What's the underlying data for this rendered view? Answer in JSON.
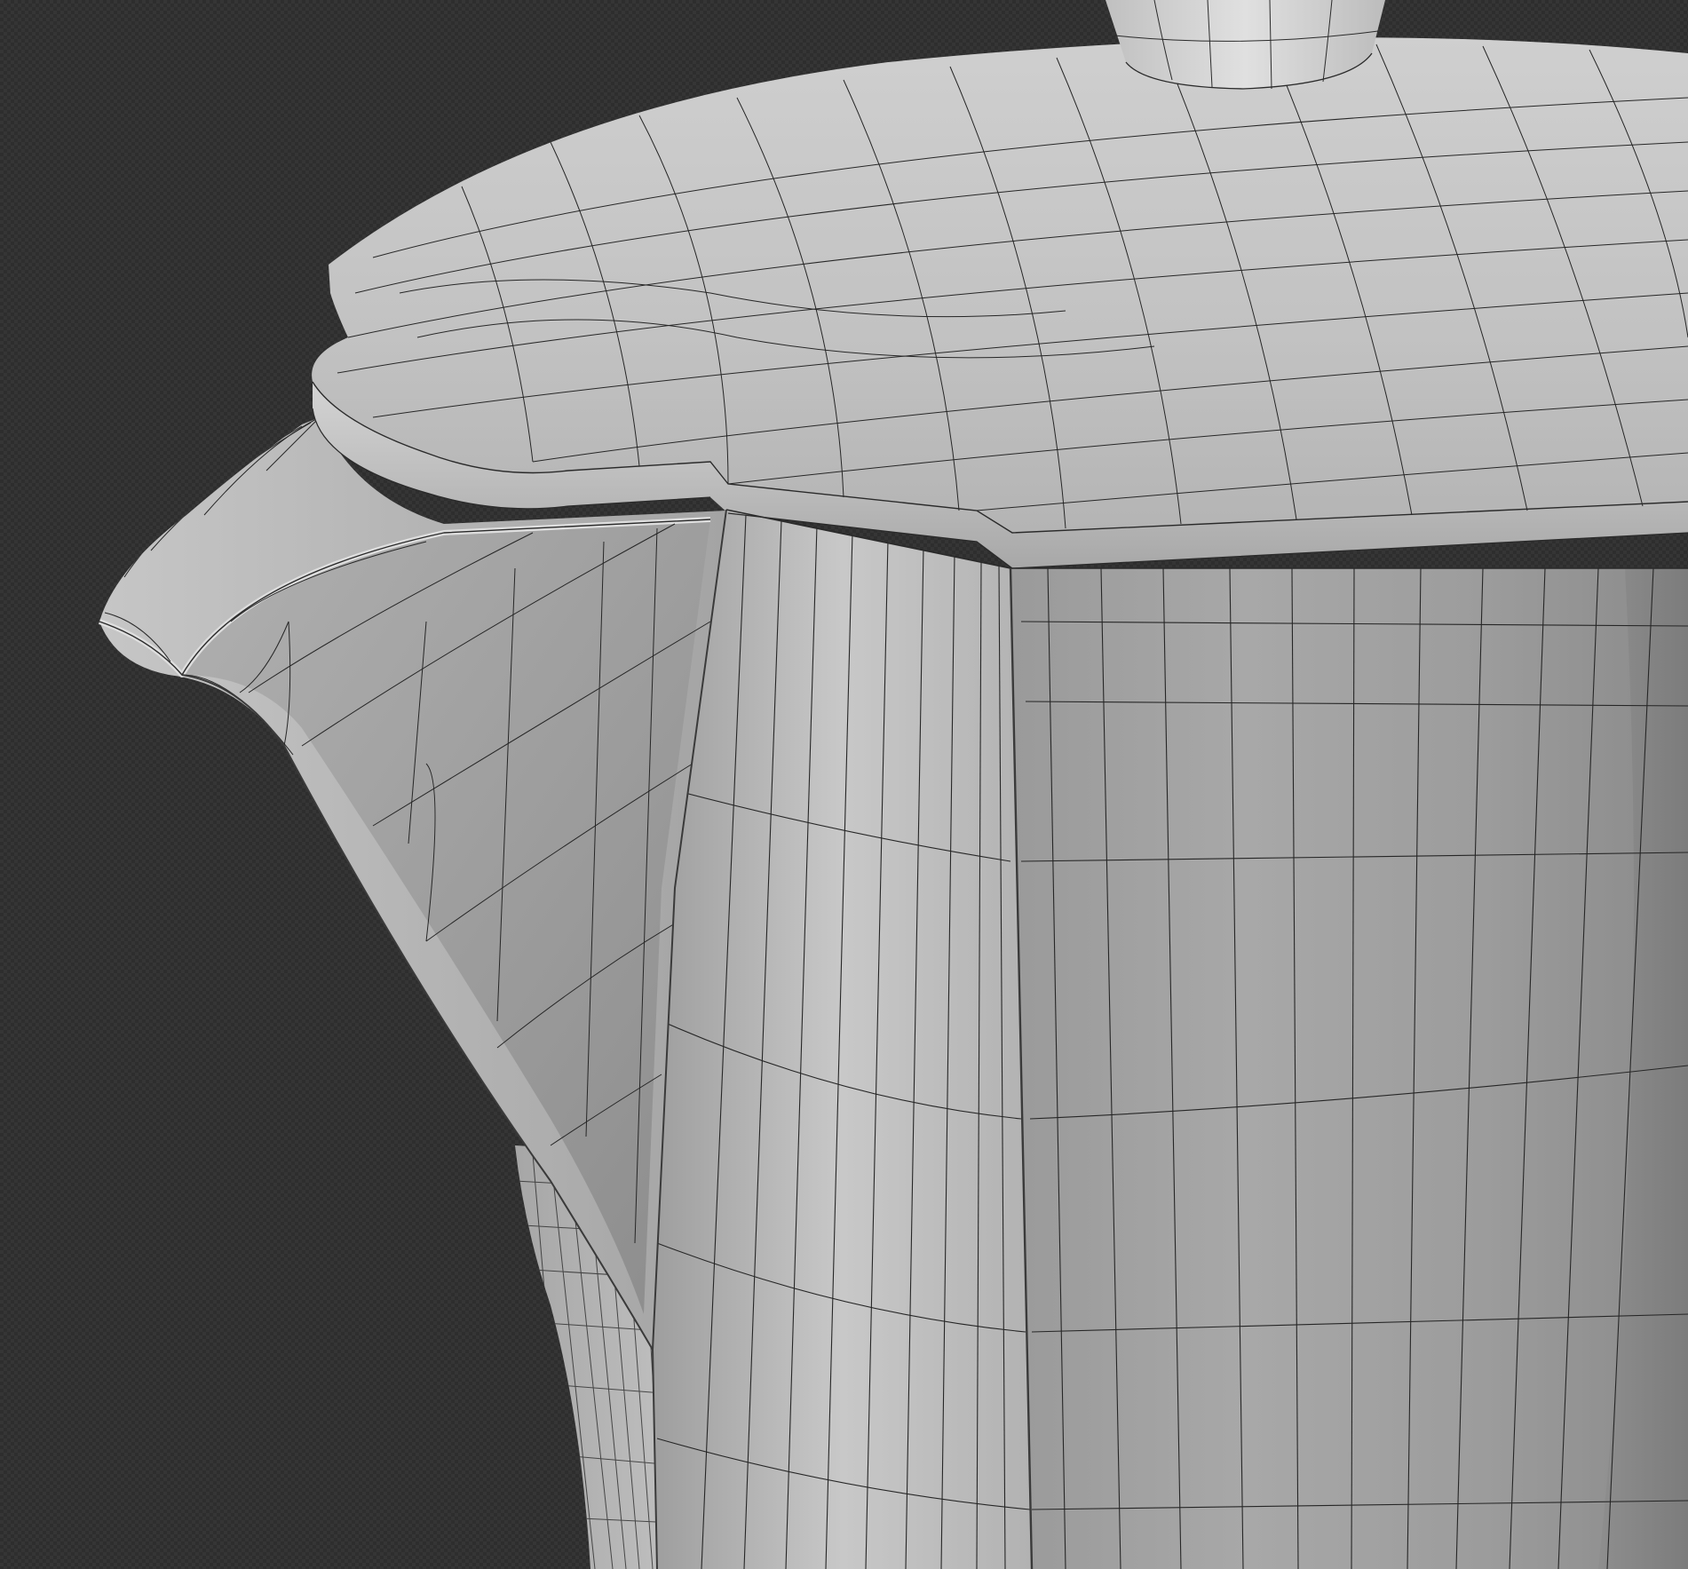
{
  "viewport": {
    "background_color": "#2e2e2e",
    "checker_color": "#353535"
  },
  "model": {
    "subject": "moka-pot",
    "surface_color": "#b4b4b4",
    "highlight_color": "#d2d2d2",
    "shadow_color": "#8a8a8a",
    "wire_color": "#1e1e1e",
    "shading": "solid-with-wireframe"
  }
}
